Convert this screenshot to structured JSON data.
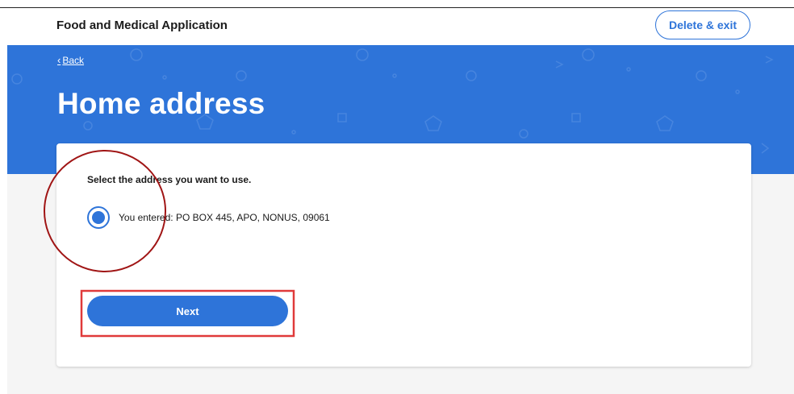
{
  "header": {
    "app_title": "Food and Medical Application",
    "delete_exit_label": "Delete & exit"
  },
  "hero": {
    "back_label": "Back",
    "page_title": "Home address"
  },
  "form": {
    "prompt": "Select the address you want to use.",
    "options": [
      {
        "label": "You entered: PO BOX 445, APO, NONUS, 09061",
        "selected": true
      }
    ],
    "next_label": "Next"
  },
  "colors": {
    "primary": "#2e74d9",
    "annotation_circle": "#a01515",
    "annotation_box": "#e03a3a",
    "background_gray": "#f5f5f5"
  },
  "icons": {
    "back": "chevron-left-icon"
  }
}
